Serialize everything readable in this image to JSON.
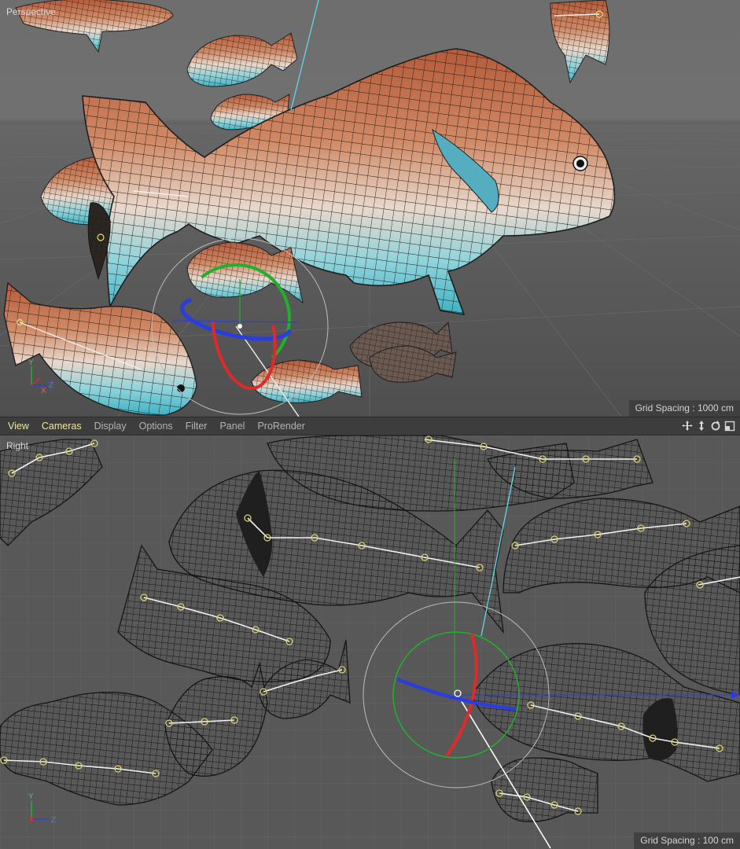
{
  "viewports": {
    "perspective": {
      "label": "Perspective",
      "grid_spacing": "Grid Spacing : 1000 cm",
      "axes": {
        "x": "X",
        "y": "Y",
        "z": "Z"
      }
    },
    "right": {
      "label": "Right",
      "grid_spacing": "Grid Spacing : 100 cm",
      "axes": {
        "y": "Y",
        "z": "Z"
      }
    }
  },
  "menubar": {
    "items": [
      "View",
      "Cameras",
      "Display",
      "Options",
      "Filter",
      "Panel",
      "ProRender"
    ],
    "active_items": [
      "View",
      "Cameras"
    ],
    "nav_icons": [
      "move-view-icon",
      "dolly-view-icon",
      "rotate-view-icon",
      "toggle-layout-icon"
    ]
  },
  "colors": {
    "fish_body": "#c26a45",
    "fish_belly": "#5fc3cf",
    "wire": "#1b1b1b",
    "gizmo_x": "#e02a2a",
    "gizmo_y": "#22b02c",
    "gizmo_z": "#2a3ee0",
    "menu_active": "#f2e98c"
  }
}
